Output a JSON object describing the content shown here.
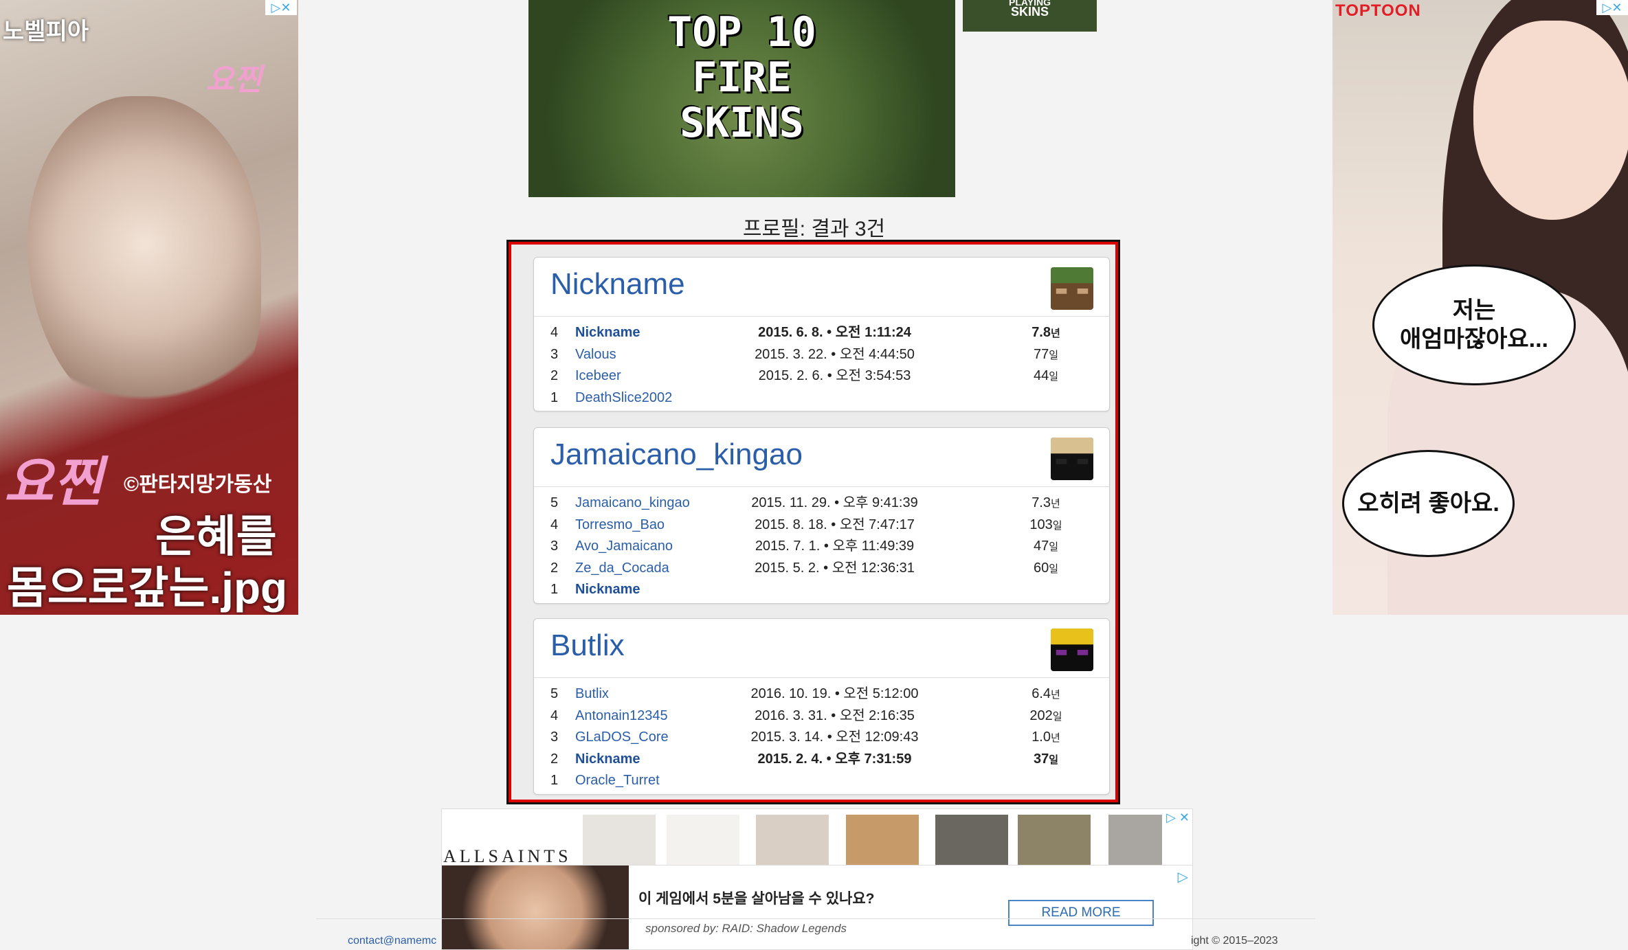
{
  "ads": {
    "left": {
      "brand": "노벨피아",
      "script_top": "요찐",
      "script_bottom": "요찐",
      "copyright": "©판타지망가동산",
      "headline_1": "은혜를",
      "headline_2": "몸으로갚는.jpg"
    },
    "right": {
      "logo": "TOPTOON",
      "bubble_1": "저는\n애엄마잖아요...",
      "bubble_2": "오히려 좋아요."
    },
    "banner": {
      "line1": "TOP 10",
      "line2": "FIRE",
      "line3": "SKINS"
    },
    "thumb": {
      "text1": "PLAYING",
      "text2": "SKINS"
    },
    "shop_brand": "ALLSAINTS",
    "promo": {
      "question": "이 게임에서 5분을 살아남을 수 있나요?",
      "sponsor": "sponsored by: RAID: Shadow Legends",
      "button": "READ MORE"
    }
  },
  "results_title": "프로필: 결과 3건",
  "profiles": [
    {
      "name": "Nickname",
      "skin_colors": [
        "#6b4a2b",
        "#4e7a36",
        "#c7a07a"
      ],
      "history": [
        {
          "n": "4",
          "name": "Nickname",
          "date": "2015. 6. 8. • 오전 1:11:24",
          "dur": "7.8",
          "unit": "년",
          "current": true
        },
        {
          "n": "3",
          "name": "Valous",
          "date": "2015. 3. 22. • 오전 4:44:50",
          "dur": "77",
          "unit": "일",
          "current": false
        },
        {
          "n": "2",
          "name": "Icebeer",
          "date": "2015. 2. 6. • 오전 3:54:53",
          "dur": "44",
          "unit": "일",
          "current": false
        },
        {
          "n": "1",
          "name": "DeathSlice2002",
          "date": "",
          "dur": "",
          "unit": "",
          "current": false
        }
      ]
    },
    {
      "name": "Jamaicano_kingao",
      "skin_colors": [
        "#111111",
        "#d8c090",
        "#222222"
      ],
      "history": [
        {
          "n": "5",
          "name": "Jamaicano_kingao",
          "date": "2015. 11. 29. • 오후 9:41:39",
          "dur": "7.3",
          "unit": "년",
          "current": false
        },
        {
          "n": "4",
          "name": "Torresmo_Bao",
          "date": "2015. 8. 18. • 오전 7:47:17",
          "dur": "103",
          "unit": "일",
          "current": false
        },
        {
          "n": "3",
          "name": "Avo_Jamaicano",
          "date": "2015. 7. 1. • 오후 11:49:39",
          "dur": "47",
          "unit": "일",
          "current": false
        },
        {
          "n": "2",
          "name": "Ze_da_Cocada",
          "date": "2015. 5. 2. • 오전 12:36:31",
          "dur": "60",
          "unit": "일",
          "current": false
        },
        {
          "n": "1",
          "name": "Nickname",
          "date": "",
          "dur": "",
          "unit": "",
          "current": true
        }
      ]
    },
    {
      "name": "Butlix",
      "skin_colors": [
        "#0d0d0d",
        "#e8c21a",
        "#7a2b8f"
      ],
      "history": [
        {
          "n": "5",
          "name": "Butlix",
          "date": "2016. 10. 19. • 오전 5:12:00",
          "dur": "6.4",
          "unit": "년",
          "current": false
        },
        {
          "n": "4",
          "name": "Antonain12345",
          "date": "2016. 3. 31. • 오전 2:16:35",
          "dur": "202",
          "unit": "일",
          "current": false
        },
        {
          "n": "3",
          "name": "GLaDOS_Core",
          "date": "2015. 3. 14. • 오전 12:09:43",
          "dur": "1.0",
          "unit": "년",
          "current": false
        },
        {
          "n": "2",
          "name": "Nickname",
          "date": "2015. 2. 4. • 오후 7:31:59",
          "dur": "37",
          "unit": "일",
          "current": true
        },
        {
          "n": "1",
          "name": "Oracle_Turret",
          "date": "",
          "dur": "",
          "unit": "",
          "current": false
        }
      ]
    }
  ],
  "footer": {
    "contact": "contact@namemc",
    "copyright": "ight © 2015–2023"
  }
}
